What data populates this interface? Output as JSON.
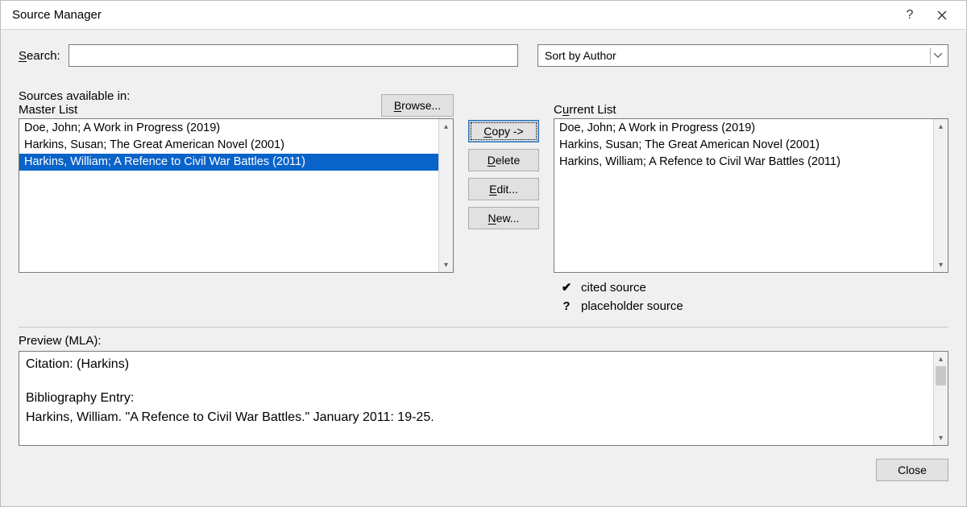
{
  "title": "Source Manager",
  "search_label": "Search:",
  "search_value": "",
  "sort_value": "Sort by Author",
  "sources_label": "Sources available in:",
  "master_label": "Master List",
  "current_label": "Current List",
  "browse_label": "Browse...",
  "master_list": [
    {
      "text": "Doe, John; A Work in Progress (2019)",
      "selected": false
    },
    {
      "text": "Harkins, Susan; The Great American Novel (2001)",
      "selected": false
    },
    {
      "text": "Harkins, William; A Refence to Civil War Battles (2011)",
      "selected": true
    }
  ],
  "current_list": [
    {
      "text": "Doe, John; A Work in Progress (2019)"
    },
    {
      "text": "Harkins, Susan; The Great American Novel (2001)"
    },
    {
      "text": "Harkins, William; A Refence to Civil War Battles (2011)"
    }
  ],
  "buttons": {
    "copy": "Copy ->",
    "delete": "Delete",
    "edit": "Edit...",
    "new": "New..."
  },
  "legend": {
    "cited_icon": "✔",
    "cited_text": "cited source",
    "placeholder_icon": "?",
    "placeholder_text": "placeholder source"
  },
  "preview_label": "Preview (MLA):",
  "preview": {
    "citation_label": "Citation:  (Harkins)",
    "bib_label": "Bibliography Entry:",
    "bib_text": "Harkins, William. \"A Refence to Civil War Battles.\" January 2011: 19-25."
  },
  "close_label": "Close"
}
